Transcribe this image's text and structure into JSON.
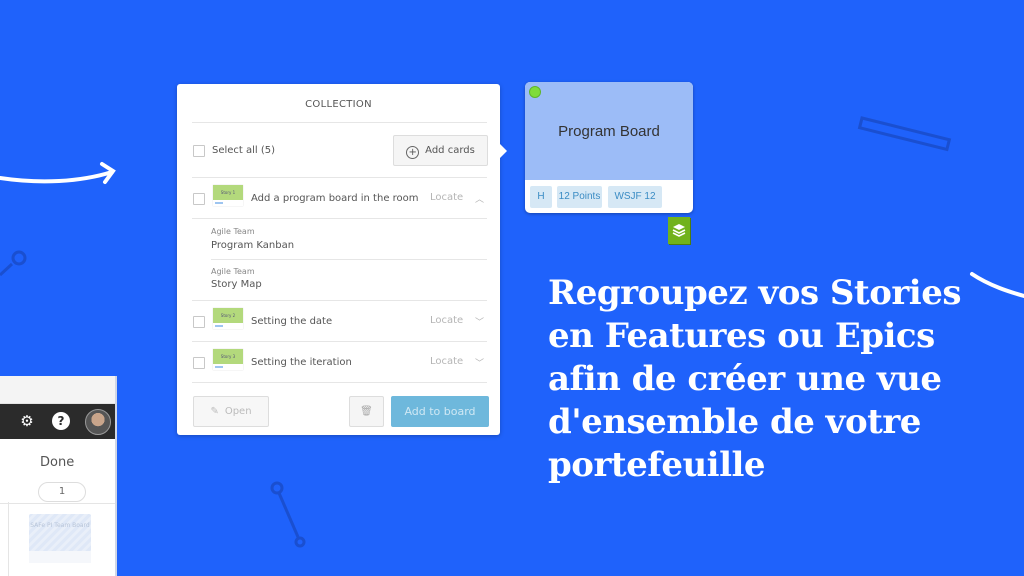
{
  "colors": {
    "background": "#1f62fb",
    "card_blue": "#9cbcf7",
    "tag_bg": "#d6e8f5",
    "tag_text": "#3b8cc4",
    "add_to_board": "#6eb8dc",
    "stack_green": "#71b21c",
    "status_dot": "#7fdc3a"
  },
  "app": {
    "icons": [
      "gear-icon",
      "help-icon",
      "avatar"
    ],
    "column": {
      "title": "Done",
      "count": "1"
    },
    "mini_card": {
      "title": "SAFe PI Team Board"
    }
  },
  "collection": {
    "title": "COLLECTION",
    "select_all": "Select all (5)",
    "add_cards": "Add cards",
    "items": [
      {
        "thumb": "Story 1",
        "title": "Add a program board in the room",
        "locate": "Locate",
        "expanded": true,
        "children": [
          {
            "label": "Agile Team",
            "value": "Program Kanban"
          },
          {
            "label": "Agile Team",
            "value": "Story Map"
          }
        ]
      },
      {
        "thumb": "Story 2",
        "title": "Setting the date",
        "locate": "Locate",
        "expanded": false
      },
      {
        "thumb": "Story 3",
        "title": "Setting the iteration",
        "locate": "Locate",
        "expanded": false
      }
    ],
    "open": "Open",
    "add_to_board": "Add to board"
  },
  "card": {
    "title": "Program Board",
    "tags": [
      "H",
      "12 Points",
      "WSJF 12"
    ]
  },
  "headline": [
    "Regroupez vos Stories",
    "en Features ou Epics",
    "afin de créer une vue",
    "d'ensemble de votre",
    "portefeuille"
  ]
}
